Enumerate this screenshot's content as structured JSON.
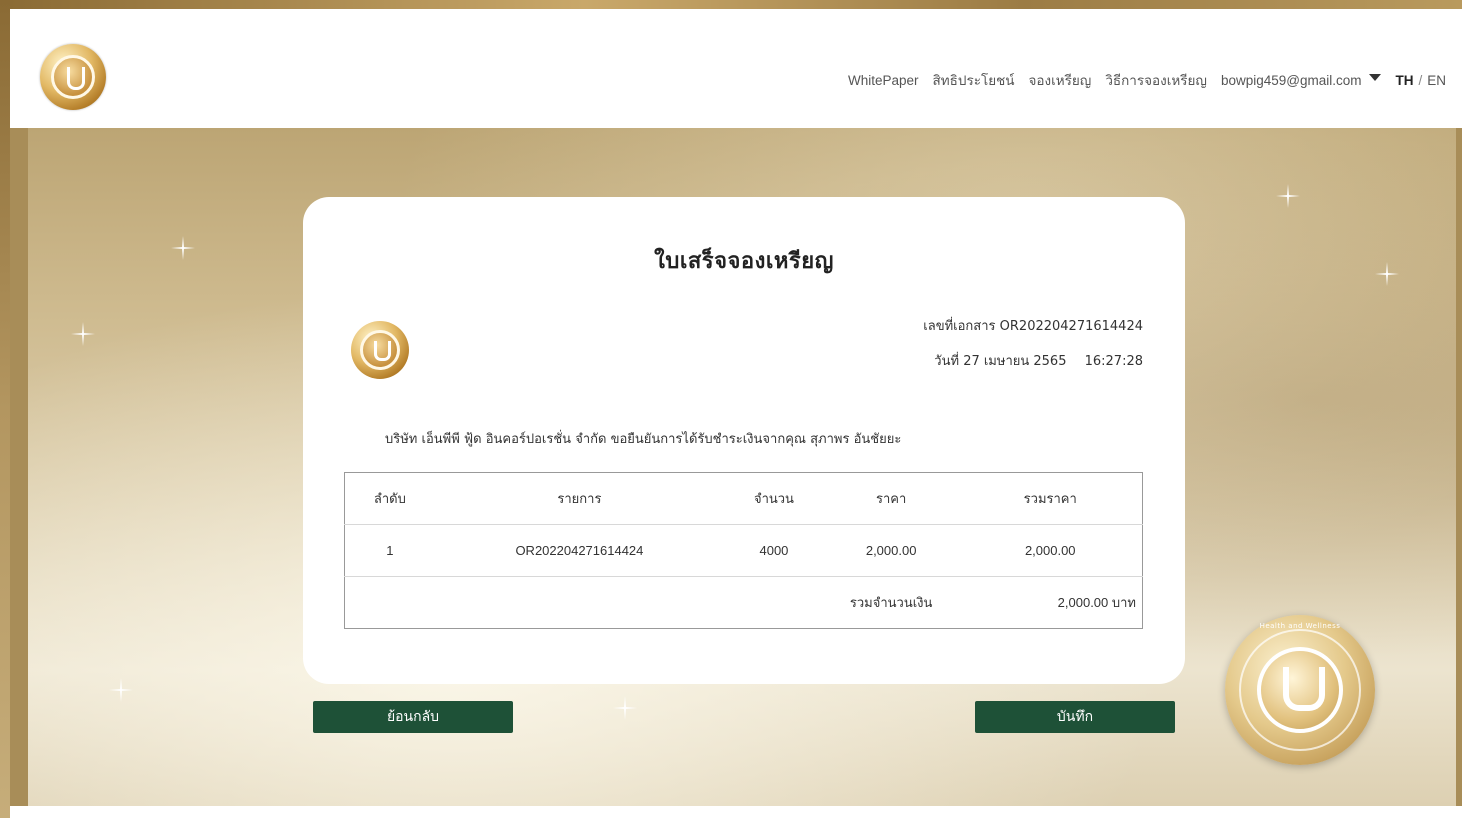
{
  "nav": {
    "items": [
      {
        "label": "WhitePaper"
      },
      {
        "label": "สิทธิประโยชน์"
      },
      {
        "label": "จองเหรียญ"
      },
      {
        "label": "วิธีการจองเหรียญ"
      }
    ],
    "user_email": "bowpig459@gmail.com",
    "lang_th": "TH",
    "lang_sep": "/",
    "lang_en": "EN"
  },
  "receipt": {
    "title": "ใบเสร็จจองเหรียญ",
    "doc_label": "เลขที่เอกสาร",
    "doc_no": "OR202204271614424",
    "date_label": "วันที่",
    "date": "27 เมษายน 2565",
    "time": "16:27:28",
    "confirm_text": "บริษัท เอ็นพีพี ฟู้ด อินคอร์ปอเรชั่น จำกัด ขอยืนยันการได้รับชำระเงินจากคุณ สุภาพร อันชัยยะ",
    "table": {
      "headers": [
        "ลำดับ",
        "รายการ",
        "จำนวน",
        "ราคา",
        "รวมราคา"
      ],
      "rows": [
        {
          "no": "1",
          "item": "OR202204271614424",
          "qty": "4000",
          "price": "2,000.00",
          "subtotal": "2,000.00"
        }
      ],
      "total_label": "รวมจำนวนเงิน",
      "total_amount": "2,000.00 บาท"
    }
  },
  "buttons": {
    "back": "ย้อนกลับ",
    "save": "บันทึก"
  },
  "coin_text": "Health and Wellness",
  "colors": {
    "button": "#1e5137",
    "gold": "#c9a460"
  }
}
